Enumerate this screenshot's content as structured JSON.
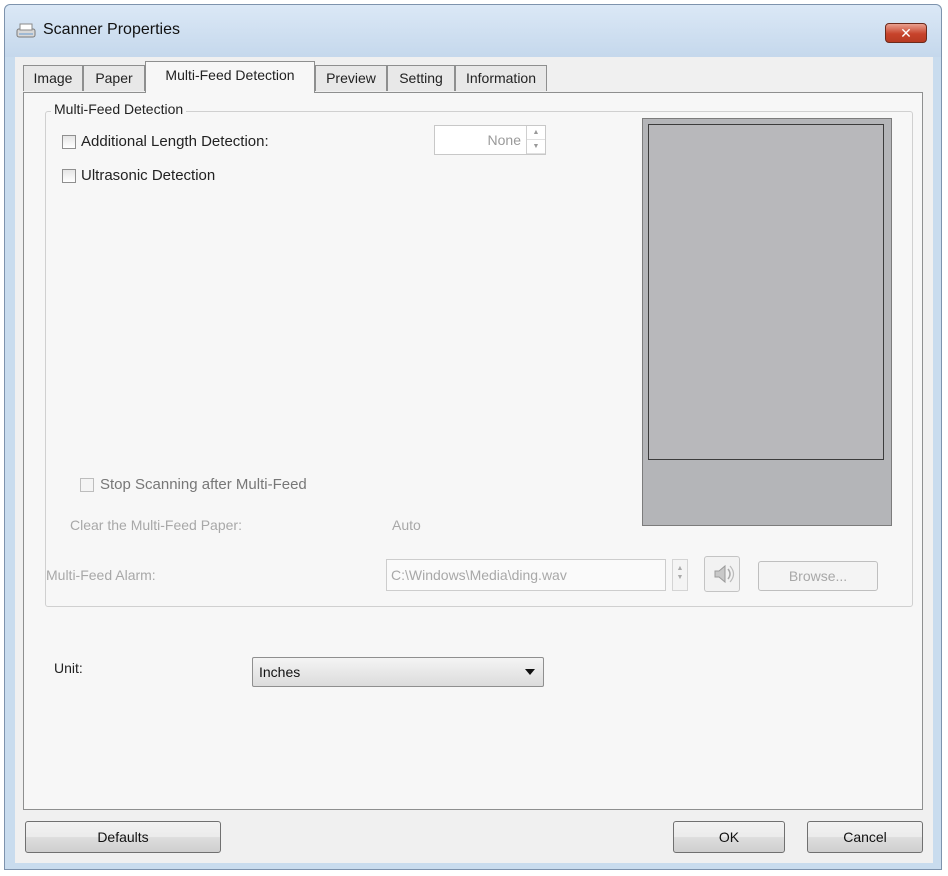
{
  "window": {
    "title": "Scanner Properties",
    "close_label": "✕"
  },
  "tabs": [
    {
      "label": "Image"
    },
    {
      "label": "Paper"
    },
    {
      "label": "Multi-Feed Detection"
    },
    {
      "label": "Preview"
    },
    {
      "label": "Setting"
    },
    {
      "label": "Information"
    }
  ],
  "active_tab": "Multi-Feed Detection",
  "multifeed": {
    "group_label": "Multi-Feed Detection",
    "length_detection_label": "Additional Length Detection:",
    "length_detection_checked": false,
    "length_value": "None",
    "ultrasonic_label": "Ultrasonic Detection",
    "ultrasonic_checked": false,
    "stop_scanning_label": "Stop Scanning after Multi-Feed",
    "stop_scanning_checked": false,
    "clear_paper_label": "Clear the Multi-Feed Paper:",
    "clear_paper_value": "Auto",
    "alarm_label": "Multi-Feed Alarm:",
    "alarm_path": "C:\\Windows\\Media\\ding.wav",
    "browse_label": "Browse..."
  },
  "unit": {
    "label": "Unit:",
    "value": "Inches"
  },
  "footer": {
    "defaults_label": "Defaults",
    "ok_label": "OK",
    "cancel_label": "Cancel"
  },
  "colors": {
    "titlebar": "#c9dcee",
    "close_button": "#c7432b",
    "preview_fill": "#b4b5b8"
  }
}
